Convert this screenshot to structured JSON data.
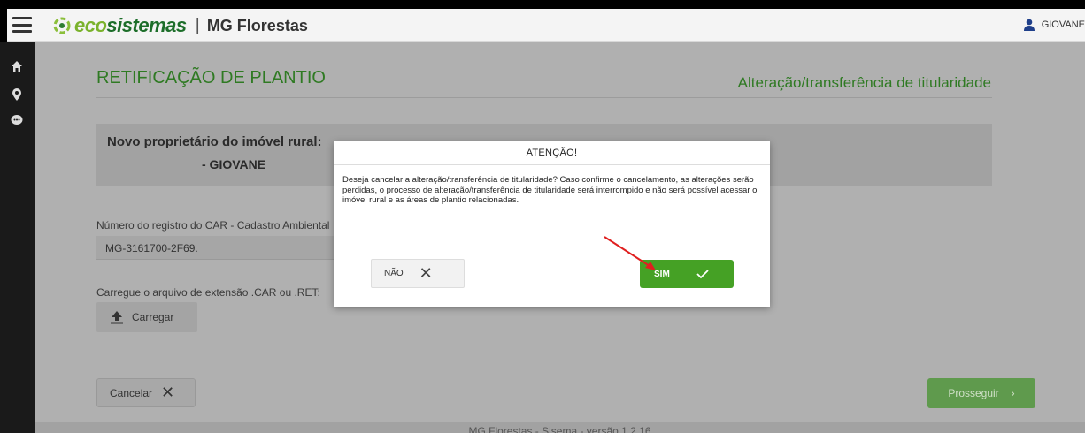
{
  "header": {
    "brand_eco": "eco",
    "brand_sistemas": "sistemas",
    "separator": "|",
    "app_name": "MG Florestas",
    "user_name": "GIOVANE"
  },
  "sidebar": {
    "items": [
      {
        "icon": "home-icon"
      },
      {
        "icon": "location-pin-icon"
      },
      {
        "icon": "chat-bubble-icon"
      }
    ]
  },
  "page": {
    "title": "RETIFICAÇÃO DE PLANTIO",
    "subtitle": "Alteração/transferência de titularidade",
    "owner_label": "Novo proprietário do imóvel rural:",
    "owner_name": "- GIOVANE",
    "car_label": "Número do registro do CAR - Cadastro Ambiental",
    "car_value": "MG-3161700-2F69.",
    "file_label": "Carregue o arquivo de extensão .CAR ou .RET:",
    "upload_label": "Carregar",
    "cancel_label": "Cancelar",
    "next_label": "Prosseguir",
    "footer": "MG Florestas - Sisema - versão 1.2.16"
  },
  "modal": {
    "title": "ATENÇÃO!",
    "message": "Deseja cancelar a alteração/transferência de titularidade? Caso confirme o cancelamento, as alterações serão perdidas, o processo de alteração/transferência de titularidade será interrompido e não será possível acessar o imóvel rural e as áreas de plantio relacionadas.",
    "no_label": "NÃO",
    "yes_label": "SIM"
  },
  "colors": {
    "brand_green": "#2f7a23",
    "confirm_green": "#45a125",
    "annotation_red": "#e02020"
  }
}
